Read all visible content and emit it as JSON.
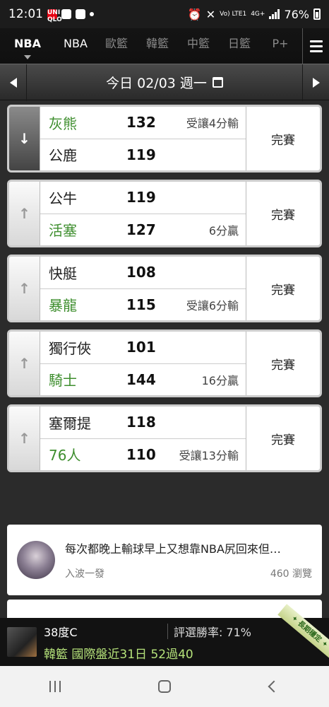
{
  "status_bar": {
    "time": "12:01",
    "uniqlo_label": "UNI QLO",
    "network_label": "Vo) LTE1",
    "network_type": "4G+",
    "battery": "76%",
    "icons": [
      "uniqlo-app-icon",
      "mail-icon",
      "gallery-icon",
      "notification-dot",
      "alarm-icon",
      "mute-icon",
      "signal-icon",
      "battery-icon"
    ]
  },
  "nav": {
    "tabs": [
      {
        "label": "NBA",
        "active": true
      },
      {
        "label": "NBA"
      },
      {
        "label": "歐籃"
      },
      {
        "label": "韓籃"
      },
      {
        "label": "中籃"
      },
      {
        "label": "日籃"
      },
      {
        "label": "P+"
      }
    ]
  },
  "date_bar": {
    "label": "今日 02/03 週一"
  },
  "games": [
    {
      "expanded": true,
      "home": {
        "team": "灰熊",
        "score": "132",
        "note": "受讓4分輸",
        "green": true
      },
      "away": {
        "team": "公鹿",
        "score": "119",
        "note": "",
        "green": false
      },
      "status": "完賽"
    },
    {
      "expanded": false,
      "home": {
        "team": "公牛",
        "score": "119",
        "note": "",
        "green": false
      },
      "away": {
        "team": "活塞",
        "score": "127",
        "note": "6分贏",
        "green": true
      },
      "status": "完賽"
    },
    {
      "expanded": false,
      "home": {
        "team": "快艇",
        "score": "108",
        "note": "",
        "green": false
      },
      "away": {
        "team": "暴龍",
        "score": "115",
        "note": "受讓6分輸",
        "green": true
      },
      "status": "完賽"
    },
    {
      "expanded": false,
      "home": {
        "team": "獨行俠",
        "score": "101",
        "note": "",
        "green": false
      },
      "away": {
        "team": "騎士",
        "score": "144",
        "note": "16分贏",
        "green": true
      },
      "status": "完賽"
    },
    {
      "expanded": false,
      "home": {
        "team": "塞爾提",
        "score": "118",
        "note": "",
        "green": false
      },
      "away": {
        "team": "76人",
        "score": "110",
        "note": "受讓13分輸",
        "green": true
      },
      "status": "完賽"
    }
  ],
  "article": {
    "title": "每次都晚上輸球早上又想靠NBA尻回來但…",
    "author": "入波一發",
    "views": "460 瀏覽"
  },
  "promo": {
    "name": "38度C",
    "win_rate": "評選勝率: 71%",
    "record": "韓籃 國際盤近31日 52過40",
    "ribbon": "✦ 長期穩定 ✦"
  },
  "colors": {
    "win_green": "#3e8e2e",
    "promo_green": "#b5e27a"
  }
}
